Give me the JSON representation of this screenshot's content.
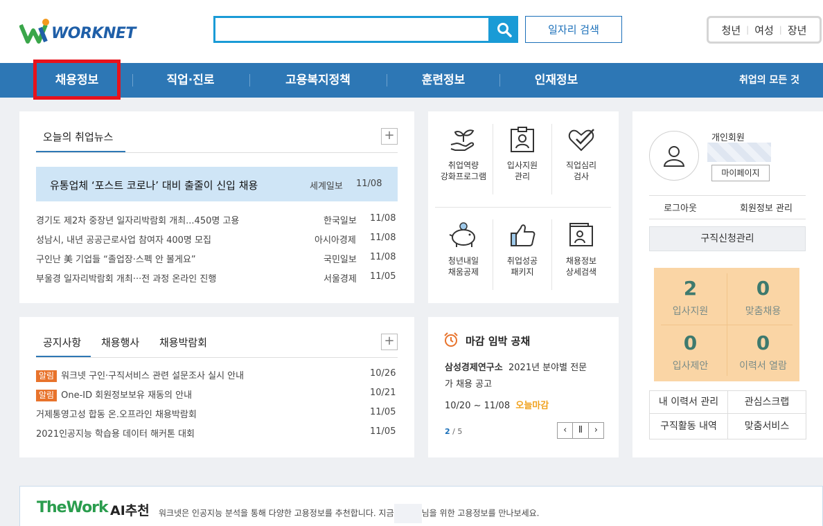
{
  "header": {
    "logo_text": "WORKNET",
    "search_placeholder": "",
    "job_search_label": "일자리 검색",
    "user_types": [
      "청년",
      "여성",
      "장년"
    ]
  },
  "nav": {
    "items": [
      "채용정보",
      "직업·진로",
      "고용복지정책",
      "훈련정보",
      "인재정보"
    ],
    "active": "채용정보",
    "right_link": "취업의 모든 것"
  },
  "news": {
    "title": "오늘의 취업뉴스",
    "highlight": {
      "title": "유통업체 ‘포스트 코로나’ 대비 출줄이 신입 채용",
      "source": "세계일보",
      "date": "11/08"
    },
    "items": [
      {
        "title": "경기도 제2차 중장년 일자리박람회 개최...450명 고용",
        "source": "한국일보",
        "date": "11/08"
      },
      {
        "title": "성남시, 내년 공공근로사업 참여자 400명 모집",
        "source": "아시아경제",
        "date": "11/08"
      },
      {
        "title": "구인난 美 기업들 “졸업장·스펙 안 볼게요”",
        "source": "국민일보",
        "date": "11/08"
      },
      {
        "title": "부울경 일자리박람회 개최···전 과정 온라인 진행",
        "source": "서울경제",
        "date": "11/05"
      }
    ]
  },
  "services": {
    "items": [
      {
        "line1": "취업역량",
        "line2": "강화프로그램",
        "icon": "sprout-hand-icon"
      },
      {
        "line1": "입사지원",
        "line2": "관리",
        "icon": "id-badge-icon"
      },
      {
        "line1": "직업심리",
        "line2": "검사",
        "icon": "heart-check-icon"
      },
      {
        "line1": "청년내일",
        "line2": "채움공제",
        "icon": "piggy-bank-icon"
      },
      {
        "line1": "취업성공",
        "line2": "패키지",
        "icon": "thumbs-up-icon"
      },
      {
        "line1": "채용정보",
        "line2": "상세검색",
        "icon": "document-search-icon"
      }
    ]
  },
  "notices": {
    "tabs": [
      "공지사항",
      "채용행사",
      "채용박람회"
    ],
    "badge_label": "알림",
    "items": [
      {
        "title": "워크넷 구인·구직서비스 관련 설문조사 실시 안내",
        "date": "10/26",
        "badge": true
      },
      {
        "title": "One-ID 회원정보보유 재동의 안내",
        "date": "10/21",
        "badge": true
      },
      {
        "title": "거제통영고성 합동 온.오프라인 채용박람회",
        "date": "11/05",
        "badge": false
      },
      {
        "title": "2021인공지능 학습용 데이터 해커톤 대회",
        "date": "11/05",
        "badge": false
      }
    ]
  },
  "deadline": {
    "title": "마감 임박 공채",
    "company": "삼성경제연구소",
    "job_line1": "2021년 분야별 전문",
    "job_line2": "가 채용 공고",
    "period": "10/20 ~ 11/08",
    "status": "오늘마감",
    "page_current": "2",
    "page_total": "/ 5",
    "prev": "‹",
    "pause": "Ⅱ",
    "next": "›"
  },
  "member": {
    "type": "개인회원",
    "mypage": "마이페이지",
    "logout": "로그아웃",
    "info": "회원정보 관리",
    "manage": "구직신청관리",
    "stats": [
      {
        "value": "2",
        "label": "입사지원"
      },
      {
        "value": "0",
        "label": "맞춤채용"
      },
      {
        "value": "0",
        "label": "입사제안"
      },
      {
        "value": "0",
        "label": "이력서 열람"
      }
    ],
    "links": [
      "내 이력서 관리",
      "관심스크랩",
      "구직활동 내역",
      "맞춤서비스"
    ]
  },
  "ai": {
    "brand": "TheWork",
    "title": "AI추천",
    "desc_before": "워크넷은 인공지능 분석을 통해 다양한 고용정보를 추천합니다. 지금",
    "desc_after": "님을 위한 고용정보를 만나보세요."
  },
  "colors": {
    "brand_blue": "#2d77b5",
    "search_blue": "#1a9bd6",
    "highlight": "#cfe5f6",
    "badge_orange": "#e8732c",
    "stat_bg": "#fad5a5",
    "active_outline": "#e8121b"
  }
}
